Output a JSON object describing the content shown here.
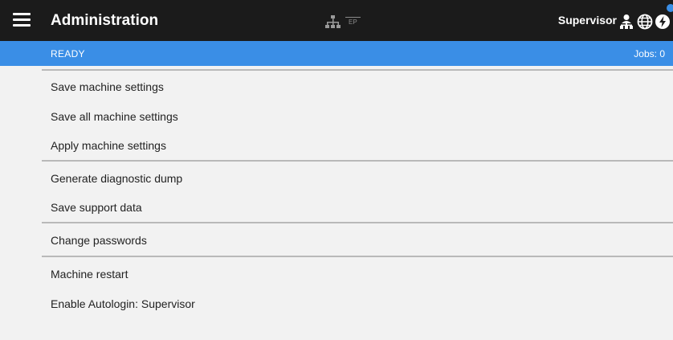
{
  "header": {
    "title": "Administration",
    "network_label": "EP",
    "user": "Supervisor"
  },
  "status": {
    "state": "READY",
    "jobs": "Jobs: 0"
  },
  "menu": {
    "items": [
      "Save machine settings",
      "Save all machine settings",
      "Apply machine settings",
      "Generate diagnostic dump",
      "Save support data",
      "Change passwords",
      "Machine restart",
      "Enable Autologin: Supervisor"
    ]
  },
  "icons": {
    "menu": "hamburger-menu-icon",
    "network": "network-tree-icon",
    "user": "user-network-icon",
    "language": "globe-icon",
    "power": "power-icon"
  },
  "colors": {
    "header_bg": "#1b1b1b",
    "status_bg": "#3a8ee6",
    "page_bg": "#f2f2f2"
  }
}
